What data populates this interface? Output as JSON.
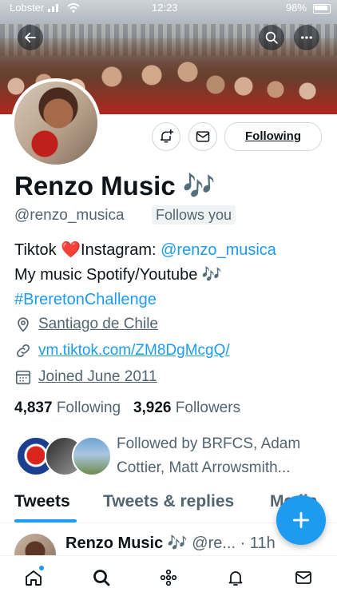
{
  "status_bar": {
    "carrier": "Lobster",
    "time": "12:23",
    "battery": "98%"
  },
  "profile": {
    "name": "Renzo Music 🎶",
    "handle": "@renzo_musica",
    "follows_you": "Follows you",
    "bio_line1_prefix": "Tiktok ❤️Instagram: ",
    "bio_line1_link": "@renzo_musica",
    "bio_line2": "My music Spotify/Youtube 🎶",
    "bio_line3": "#BreretonChallenge",
    "location": "Santiago de Chile",
    "website": "vm.tiktok.com/ZM8DgMcgQ/",
    "joined": "Joined June 2011",
    "following_count": "4,837",
    "following_label": "Following",
    "followers_count": "3,926",
    "followers_label": "Followers",
    "followed_by": "Followed by BRFCS, Adam Cottier, Matt Arrowsmith..."
  },
  "actions": {
    "following_button": "Following"
  },
  "tabs": [
    {
      "label": "Tweets"
    },
    {
      "label": "Tweets & replies"
    },
    {
      "label": "Media"
    }
  ],
  "tweet": {
    "name": "Renzo Music 🎶",
    "handle": "@re...",
    "time": "· 11h"
  },
  "colors": {
    "accent": "#1d9bf0",
    "text": "#0f1419",
    "secondary": "#536471"
  }
}
